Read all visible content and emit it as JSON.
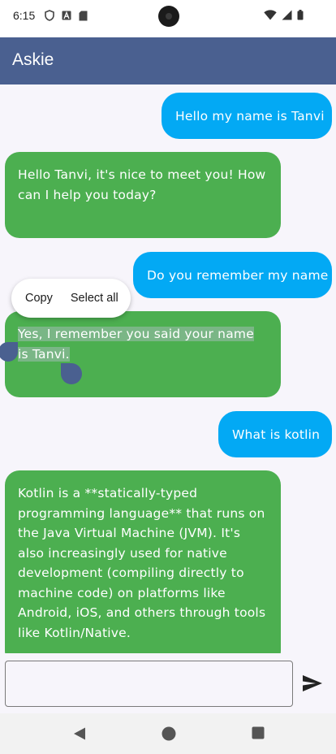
{
  "status_bar": {
    "time": "6:15"
  },
  "app_bar": {
    "title": "Askie",
    "color": "#4a6090"
  },
  "messages": [
    {
      "sender": "user",
      "text": "Hello my name is Tanvi"
    },
    {
      "sender": "bot",
      "text": "Hello Tanvi, it's nice to meet you!  How can I help you today?"
    },
    {
      "sender": "user",
      "text": "Do you remember my name"
    },
    {
      "sender": "bot",
      "text": "Yes, I remember you said your name is Tanvi.",
      "selected": true
    },
    {
      "sender": "user",
      "text": "What is kotlin"
    },
    {
      "sender": "bot",
      "text": "Kotlin is a **statically-typed programming language** that runs on the Java Virtual Machine (JVM).  It's also increasingly used for native development (compiling directly to machine code) on platforms like Android, iOS, and others through tools like Kotlin/Native."
    }
  ],
  "context_menu": {
    "copy_label": "Copy",
    "select_all_label": "Select all"
  },
  "input": {
    "value": "",
    "placeholder": ""
  },
  "colors": {
    "user_bubble": "#03a9f4",
    "bot_bubble": "#4caf50",
    "background": "#f7f5fb"
  },
  "icons": {
    "send": "send-icon",
    "back": "nav-back-icon",
    "home": "nav-home-icon",
    "recents": "nav-recents-icon"
  }
}
